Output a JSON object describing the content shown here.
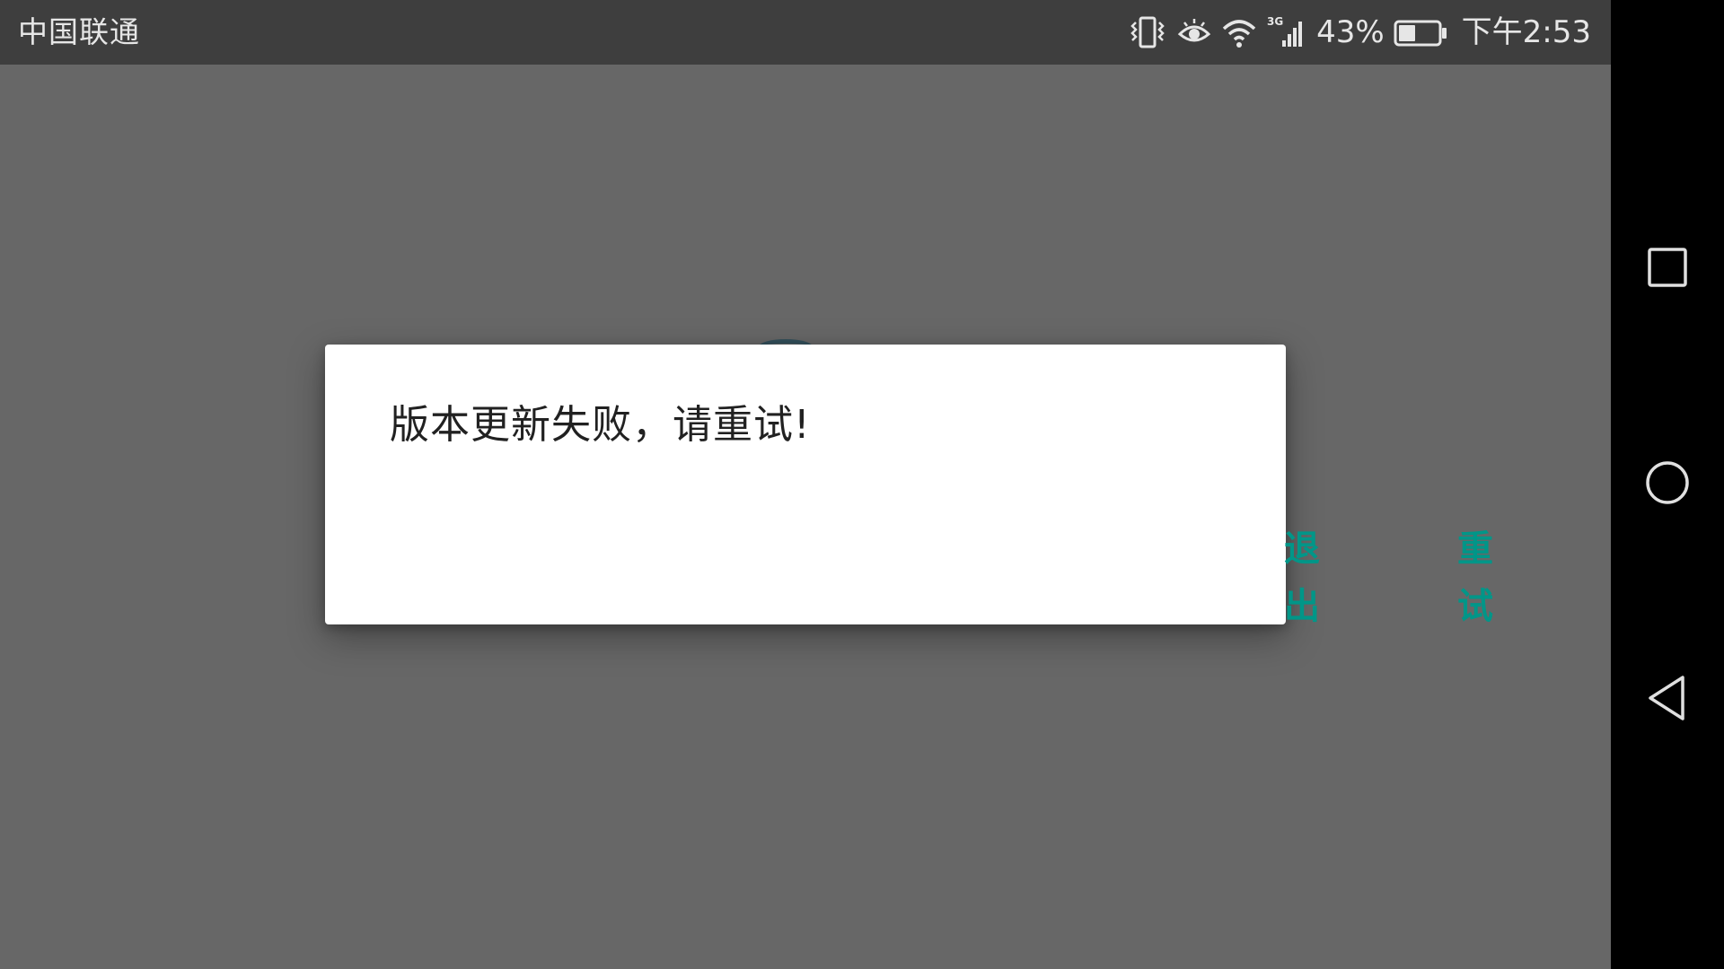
{
  "status_bar": {
    "carrier": "中国联通",
    "network_type": "3G",
    "battery_percent": "43%",
    "battery_level": 0.43,
    "time": "下午2:53",
    "icons": [
      "vibrate-icon",
      "eye-comfort-icon",
      "wifi-icon",
      "signal-icon",
      "battery-icon"
    ]
  },
  "dialog": {
    "message": "版本更新失败，请重试!",
    "buttons": {
      "exit": "退出",
      "retry": "重试"
    },
    "accent_color": "#009688"
  },
  "navigation_bar": {
    "icons": [
      "recents-icon",
      "home-icon",
      "back-icon"
    ]
  },
  "colors": {
    "status_bar": "#3e3e3e",
    "scrim": "#676767",
    "nav_bar": "#000000",
    "dialog_bg": "#ffffff",
    "message_text": "#212121"
  }
}
